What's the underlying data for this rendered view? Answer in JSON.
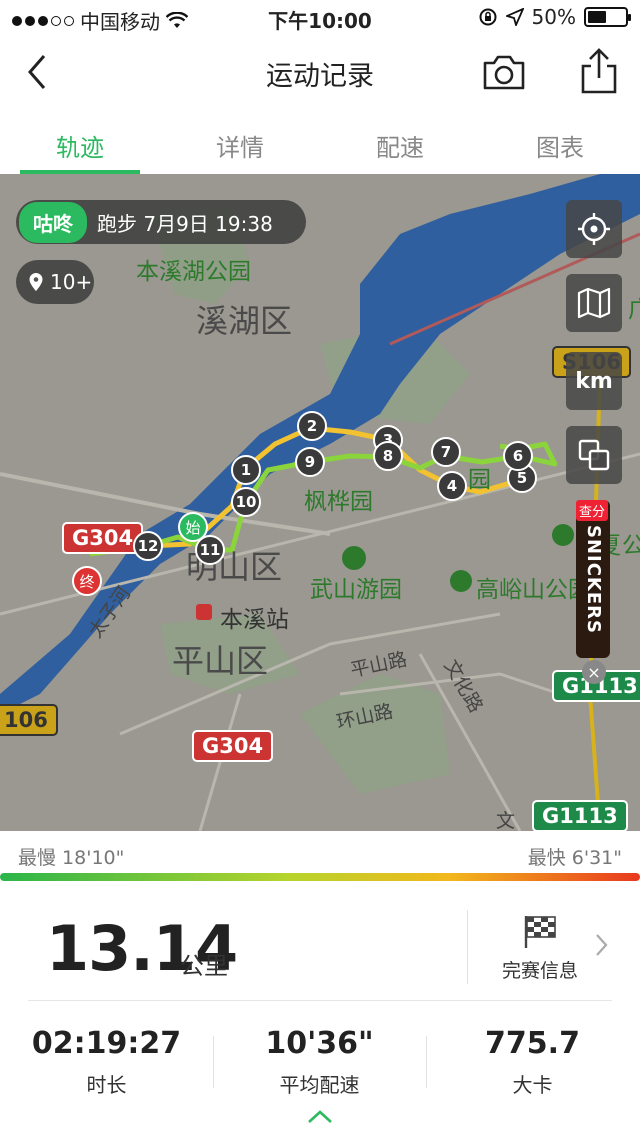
{
  "status_bar": {
    "carrier": "中国移动",
    "time": "下午10:00",
    "battery": "50%"
  },
  "nav": {
    "title": "运动记录"
  },
  "tabs": [
    {
      "label": "轨迹",
      "active": true
    },
    {
      "label": "详情",
      "active": false
    },
    {
      "label": "配速",
      "active": false
    },
    {
      "label": "图表",
      "active": false
    }
  ],
  "map": {
    "session_tag": "咕咚",
    "session_info": "跑步 7月9日 19:38",
    "poi_count": "10+",
    "km_button": "km",
    "labels": {
      "park1": "本溪湖公园",
      "district1": "溪湖区",
      "park2": "枫桦园",
      "park3": "武山游园",
      "park4": "高峪山公园",
      "district2": "明山区",
      "station": "本溪站",
      "district3": "平山区",
      "road1": "平山路",
      "road2": "环山路",
      "road3": "文化路",
      "river": "太子河",
      "partial_gongyuan": "公",
      "partial_jia": "夏",
      "partial_a": "园",
      "partial_guang": "广",
      "partial_wen": "文"
    },
    "shields": {
      "g304_top": "G304",
      "g304_bottom": "G304",
      "s106_right": "S106",
      "s106_left": "106",
      "g1113_right": "G1113",
      "g1113_bottom": "G1113"
    },
    "markers": [
      "1",
      "2",
      "3",
      "4",
      "5",
      "6",
      "7",
      "8",
      "9",
      "10",
      "11",
      "12"
    ],
    "start_label": "始",
    "end_label": "终",
    "ad": {
      "badge": "查分",
      "brand": "SNICKERS",
      "close": "×"
    }
  },
  "pace": {
    "slowest": "最慢 18'10\"",
    "fastest": "最快 6'31\""
  },
  "summary": {
    "distance": "13.14",
    "distance_unit": "公里",
    "finish_label": "完赛信息"
  },
  "stats": [
    {
      "value": "02:19:27",
      "label": "时长"
    },
    {
      "value": "10'36\"",
      "label": "平均配速"
    },
    {
      "value": "775.7",
      "label": "大卡"
    }
  ],
  "colors": {
    "accent": "#2bba5f",
    "map_bg": "#9a9890",
    "river": "#2f5f9e"
  }
}
